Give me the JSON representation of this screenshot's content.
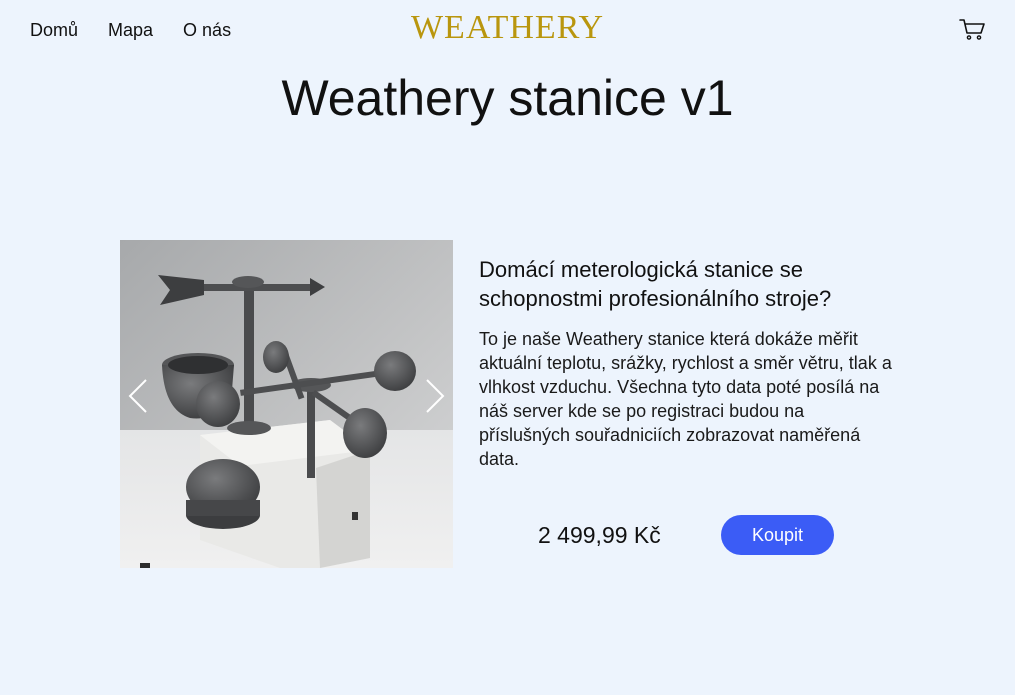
{
  "nav": {
    "items": [
      {
        "label": "Domů"
      },
      {
        "label": "Mapa"
      },
      {
        "label": "O nás"
      }
    ]
  },
  "header": {
    "logo": "WEATHERY",
    "cart_icon": "cart-icon"
  },
  "page": {
    "title": "Weathery stanice v1"
  },
  "product": {
    "heading": "Domácí meterologická stanice se schopnostmi profesionálního stroje?",
    "description": "To je naše Weathery stanice která dokáže měřit aktuální teplotu, srážky, rychlost a směr větru, tlak a vlhkost vzduchu. Všechna tyto data poté posílá na náš server kde se po registraci budou na příslušných souřadniciích zobrazovat naměřená data.",
    "price": "2 499,99 Kč",
    "buy_label": "Koupit",
    "carousel": {
      "prev_icon": "chevron-left-icon",
      "next_icon": "chevron-right-icon"
    }
  },
  "colors": {
    "background": "#edf4fd",
    "logo": "#b9960e",
    "button": "#3b5cf6"
  }
}
